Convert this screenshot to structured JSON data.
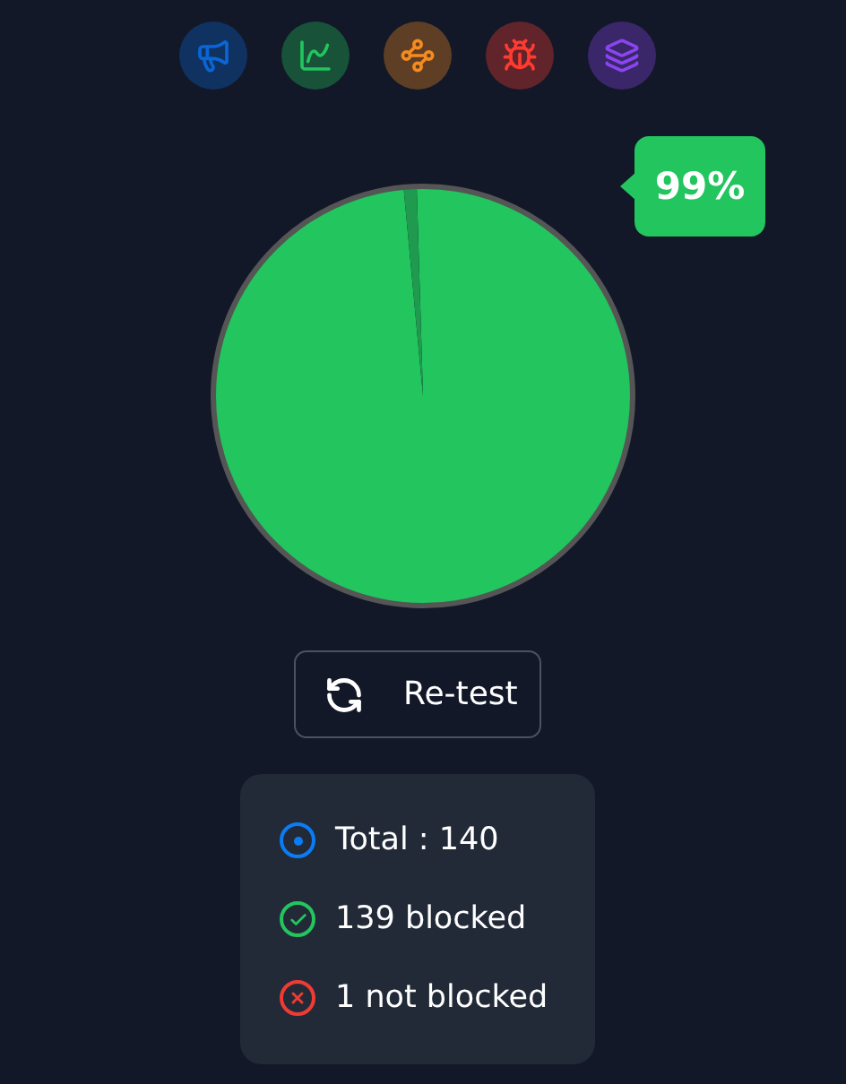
{
  "icons": [
    {
      "kind": "megaphone",
      "color": "#0a66d6"
    },
    {
      "kind": "chart",
      "color": "#22c55e"
    },
    {
      "kind": "network",
      "color": "#f58a1f"
    },
    {
      "kind": "bug",
      "color": "#ff3b30"
    },
    {
      "kind": "layers",
      "color": "#8b45f0"
    }
  ],
  "result": {
    "percent": "99%",
    "chart_data": {
      "type": "pie",
      "values": [
        99,
        1
      ]
    }
  },
  "retest_button": {
    "label": "Re-test"
  },
  "summary": [
    {
      "kind": "total",
      "label": "Total : 140",
      "color": "#0a7cf5"
    },
    {
      "kind": "blocked",
      "label": "139 blocked",
      "color": "#22c55e"
    },
    {
      "kind": "not_blocked",
      "label": "1 not blocked",
      "color": "#ef3b33"
    }
  ]
}
